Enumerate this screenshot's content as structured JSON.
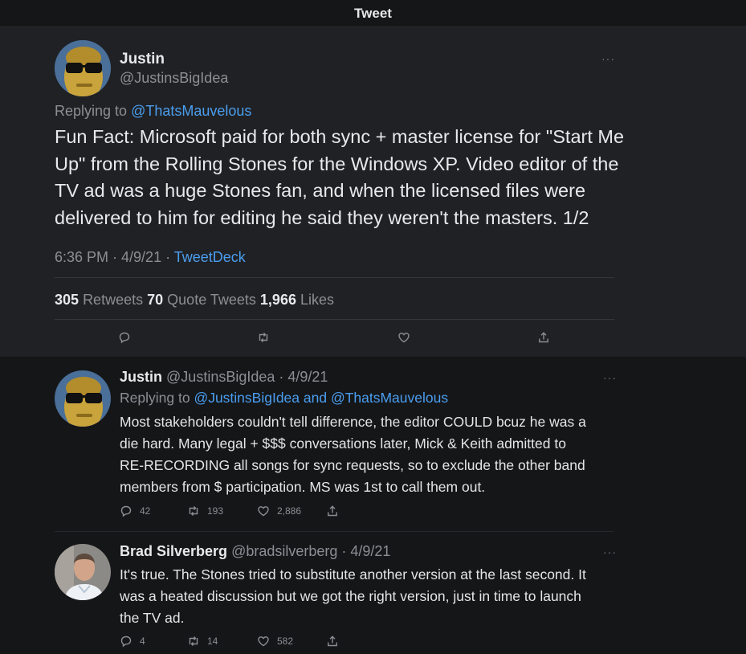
{
  "header": {
    "title": "Tweet"
  },
  "main_tweet": {
    "author_name": "Justin",
    "author_handle": "@JustinsBigIdea",
    "replying_label": "Replying to",
    "replying_to": "@ThatsMauvelous",
    "text_lines": [
      "Fun Fact: Microsoft paid for both sync + master license for \"Start Me",
      "Up\" from the Rolling Stones for the Windows XP. Video editor of the",
      "TV ad was a huge Stones fan, and when the licensed files were",
      "delivered to him for editing he said they weren't the masters. 1/2"
    ],
    "time": "6:36 PM · 4/9/21 ·",
    "source": "TweetDeck",
    "retweets_count": "305",
    "retweets_label": "Retweets",
    "quotes_count": "70",
    "quotes_label": "Quote Tweets",
    "likes_count": "1,966",
    "likes_label": "Likes",
    "more": "···"
  },
  "replies": [
    {
      "author_name": "Justin",
      "meta": "@JustinsBigIdea · 4/9/21",
      "replying_label": "Replying to",
      "replying_to": "@JustinsBigIdea and @ThatsMauvelous",
      "text_lines": [
        "Most stakeholders couldn't tell difference, the editor COULD bcuz he was a",
        "die hard. Many legal + $$$ conversations later, Mick & Keith admitted to",
        "RE-RECORDING all songs for sync requests, so to exclude the other band",
        "members from $ participation. MS was 1st to call them out."
      ],
      "reply_count": "42",
      "retweet_count": "193",
      "like_count": "2,886",
      "more": "···"
    },
    {
      "author_name": "Brad Silverberg",
      "meta": "@bradsilverberg · 4/9/21",
      "text_lines": [
        "It's true. The Stones tried to substitute another version at the last second. It",
        "was a heated discussion but we got the right version, just in time to launch",
        "the TV ad."
      ],
      "reply_count": "4",
      "retweet_count": "14",
      "like_count": "582",
      "more": "···"
    }
  ],
  "icons": [
    "reply-icon",
    "retweet-icon",
    "like-icon",
    "share-icon",
    "more-icon"
  ],
  "colors": {
    "background": "#151618",
    "card": "#202124",
    "link": "#4a9ef0",
    "muted": "#8b8f94"
  }
}
